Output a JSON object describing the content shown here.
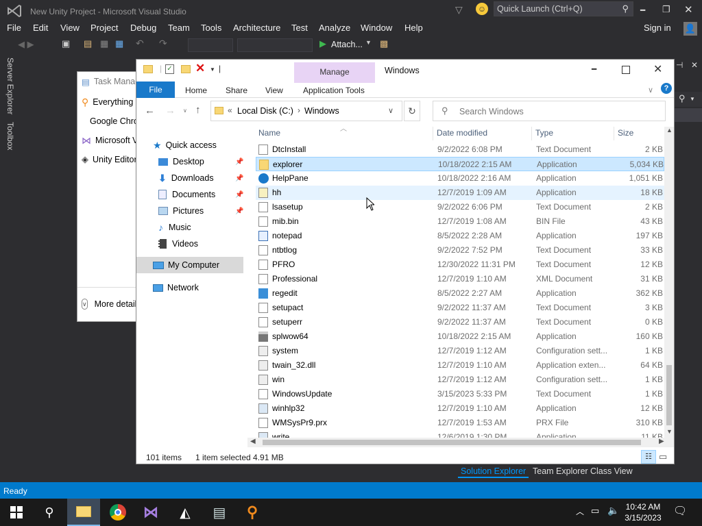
{
  "vs": {
    "title": "New Unity Project - Microsoft Visual Studio",
    "quick_launch_placeholder": "Quick Launch (Ctrl+Q)",
    "menu": [
      "File",
      "Edit",
      "View",
      "Project",
      "Debug",
      "Team",
      "Tools",
      "Architecture",
      "Test",
      "Analyze",
      "Window",
      "Help"
    ],
    "sign_in": "Sign in",
    "attach_label": "Attach...",
    "side_tabs": [
      "Server Explorer",
      "Toolbox"
    ],
    "status": "Ready",
    "bottom_tabs": [
      "Solution Explorer",
      "Team Explorer",
      "Class View"
    ]
  },
  "taskmgr": {
    "title": "Task Manager",
    "items": [
      "Everything",
      "Google Chrome",
      "Microsoft Visual Studio",
      "Unity Editor"
    ],
    "more_details": "More details"
  },
  "explorer": {
    "contextual_tab": "Manage",
    "window_title": "Windows",
    "ribbon_tabs": [
      "File",
      "Home",
      "Share",
      "View",
      "Application Tools"
    ],
    "breadcrumb": [
      "Local Disk (C:)",
      "Windows"
    ],
    "search_placeholder": "Search Windows",
    "nav": {
      "quick_access": "Quick access",
      "items": [
        "Desktop",
        "Downloads",
        "Documents",
        "Pictures",
        "Music",
        "Videos"
      ],
      "my_computer": "My Computer",
      "network": "Network"
    },
    "columns": [
      "Name",
      "Date modified",
      "Type",
      "Size"
    ],
    "files": [
      {
        "name": "DtcInstall",
        "date": "9/2/2022 6:08 PM",
        "type": "Text Document",
        "size": "2 KB",
        "icon": "text"
      },
      {
        "name": "explorer",
        "date": "10/18/2022 2:15 AM",
        "type": "Application",
        "size": "5,034 KB",
        "icon": "explorer"
      },
      {
        "name": "HelpPane",
        "date": "10/18/2022 2:16 AM",
        "type": "Application",
        "size": "1,051 KB",
        "icon": "help"
      },
      {
        "name": "hh",
        "date": "12/7/2019 1:09 AM",
        "type": "Application",
        "size": "18 KB",
        "icon": "hh"
      },
      {
        "name": "lsasetup",
        "date": "9/2/2022 6:06 PM",
        "type": "Text Document",
        "size": "2 KB",
        "icon": "text"
      },
      {
        "name": "mib.bin",
        "date": "12/7/2019 1:08 AM",
        "type": "BIN File",
        "size": "43 KB",
        "icon": "file"
      },
      {
        "name": "notepad",
        "date": "8/5/2022 2:28 AM",
        "type": "Application",
        "size": "197 KB",
        "icon": "notepad"
      },
      {
        "name": "ntbtlog",
        "date": "9/2/2022 7:52 PM",
        "type": "Text Document",
        "size": "33 KB",
        "icon": "text"
      },
      {
        "name": "PFRO",
        "date": "12/30/2022 11:31 PM",
        "type": "Text Document",
        "size": "12 KB",
        "icon": "text"
      },
      {
        "name": "Professional",
        "date": "12/7/2019 1:10 AM",
        "type": "XML Document",
        "size": "31 KB",
        "icon": "xml"
      },
      {
        "name": "regedit",
        "date": "8/5/2022 2:27 AM",
        "type": "Application",
        "size": "362 KB",
        "icon": "regedit"
      },
      {
        "name": "setupact",
        "date": "9/2/2022 11:37 AM",
        "type": "Text Document",
        "size": "3 KB",
        "icon": "text"
      },
      {
        "name": "setuperr",
        "date": "9/2/2022 11:37 AM",
        "type": "Text Document",
        "size": "0 KB",
        "icon": "text"
      },
      {
        "name": "splwow64",
        "date": "10/18/2022 2:15 AM",
        "type": "Application",
        "size": "160 KB",
        "icon": "printer"
      },
      {
        "name": "system",
        "date": "12/7/2019 1:12 AM",
        "type": "Configuration sett...",
        "size": "1 KB",
        "icon": "config"
      },
      {
        "name": "twain_32.dll",
        "date": "12/7/2019 1:10 AM",
        "type": "Application exten...",
        "size": "64 KB",
        "icon": "config"
      },
      {
        "name": "win",
        "date": "12/7/2019 1:12 AM",
        "type": "Configuration sett...",
        "size": "1 KB",
        "icon": "config"
      },
      {
        "name": "WindowsUpdate",
        "date": "3/15/2023 5:33 PM",
        "type": "Text Document",
        "size": "1 KB",
        "icon": "text"
      },
      {
        "name": "winhlp32",
        "date": "12/7/2019 1:10 AM",
        "type": "Application",
        "size": "12 KB",
        "icon": "app"
      },
      {
        "name": "WMSysPr9.prx",
        "date": "12/7/2019 1:53 AM",
        "type": "PRX File",
        "size": "310 KB",
        "icon": "file"
      },
      {
        "name": "write",
        "date": "12/6/2019 1:30 PM",
        "type": "Application",
        "size": "11 KB",
        "icon": "app"
      }
    ],
    "status_count": "101 items",
    "status_selected": "1 item selected  4.91 MB"
  },
  "clock": {
    "time": "10:42 AM",
    "date": "3/15/2023"
  },
  "colors": {
    "vs_bg": "#2d2d30",
    "vs_status": "#007acc",
    "selection": "#cce8ff",
    "ribbon_blue": "#1979ca",
    "manage_tab": "#e8d4f5"
  }
}
